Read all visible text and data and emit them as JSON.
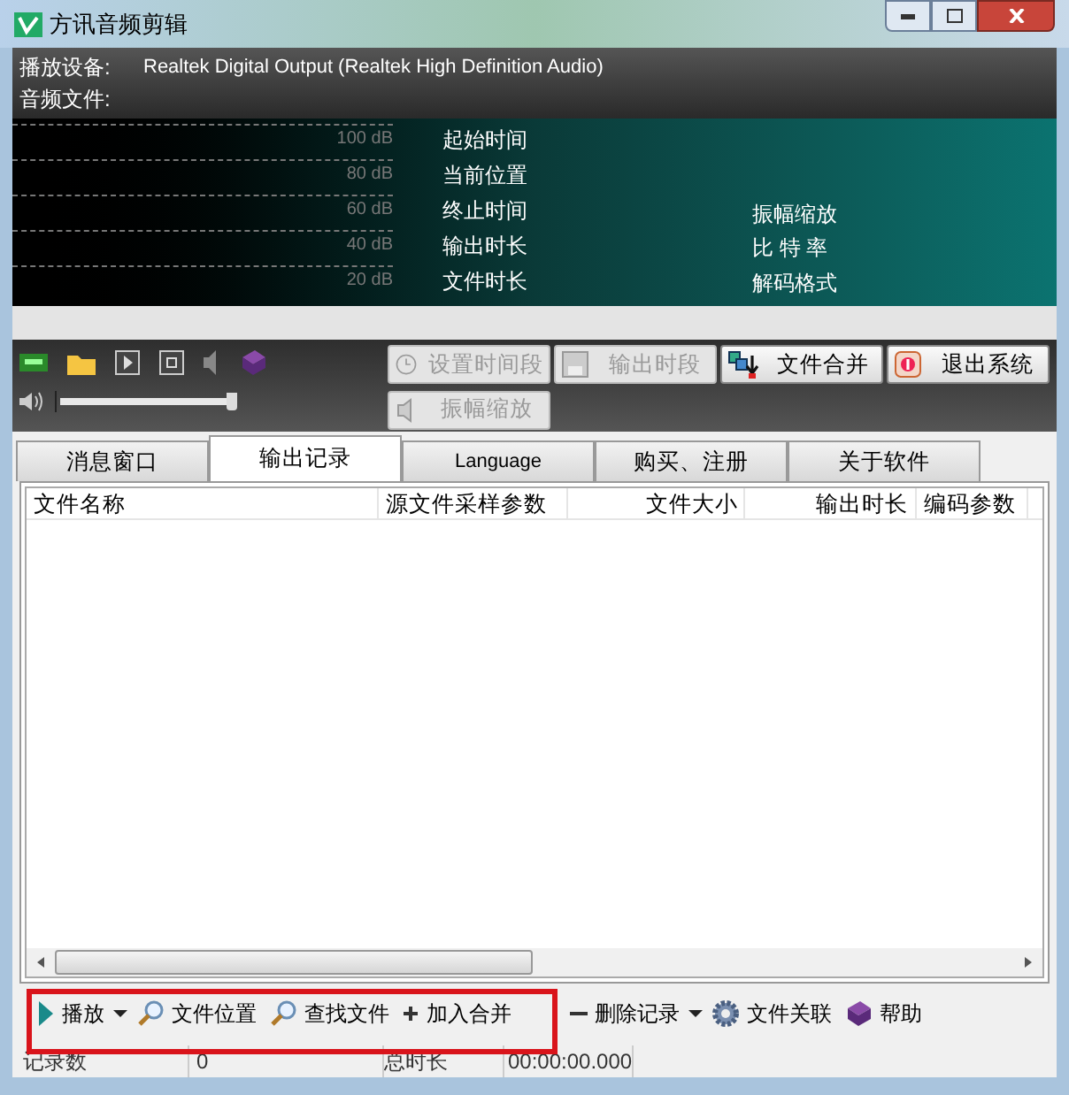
{
  "window": {
    "title": "方讯音频剪辑"
  },
  "info": [
    {
      "label": "播放设备:",
      "value": "Realtek Digital Output (Realtek High Definition Audio)"
    },
    {
      "label": "音频文件:"
    }
  ],
  "display": {
    "scale": [
      "100 dB",
      "80 dB",
      "60 dB",
      "40 dB",
      "20 dB"
    ],
    "fields_left": [
      "起始时间",
      "当前位置",
      "终止时间",
      "输出时长",
      "文件时长"
    ],
    "fields_right": [
      "振幅缩放",
      "比 特 率",
      "解码格式"
    ]
  },
  "volume": {
    "level": 0.93
  },
  "buttons": [
    {
      "label": "设置时间段",
      "kind": "clock",
      "disabled": true
    },
    {
      "label": "输出时段",
      "kind": "save",
      "disabled": true
    },
    {
      "label": "文件合并",
      "kind": "merge",
      "disabled": false
    },
    {
      "label": "退出系统",
      "kind": "exit",
      "disabled": false
    },
    {
      "label": "振幅缩放",
      "kind": "speaker",
      "disabled": true
    }
  ],
  "tabs": [
    {
      "label": "消息窗口",
      "selected": false
    },
    {
      "label": "输出记录",
      "selected": true
    },
    {
      "label": "Language",
      "selected": false
    },
    {
      "label": "购买、注册",
      "selected": false
    },
    {
      "label": "关于软件",
      "selected": false
    }
  ],
  "table": {
    "columns": [
      "文件名称",
      "源文件采样参数",
      "文件大小",
      "输出时长",
      "编码参数"
    ]
  },
  "bottom_toolbar": [
    {
      "label": "播放",
      "kind": "play",
      "dropdown": true
    },
    {
      "label": "文件位置",
      "kind": "search",
      "dropdown": false
    },
    {
      "label": "查找文件",
      "kind": "search",
      "dropdown": false
    },
    {
      "label": "加入合并",
      "kind": "plus",
      "dropdown": false
    },
    {
      "label": "删除记录",
      "kind": "minus",
      "dropdown": true
    },
    {
      "label": "文件关联",
      "kind": "gear",
      "dropdown": false
    },
    {
      "label": "帮助",
      "kind": "book",
      "dropdown": false
    }
  ],
  "status_bar": [
    "记录数",
    "0",
    "总时长",
    "00:00:00.000"
  ]
}
